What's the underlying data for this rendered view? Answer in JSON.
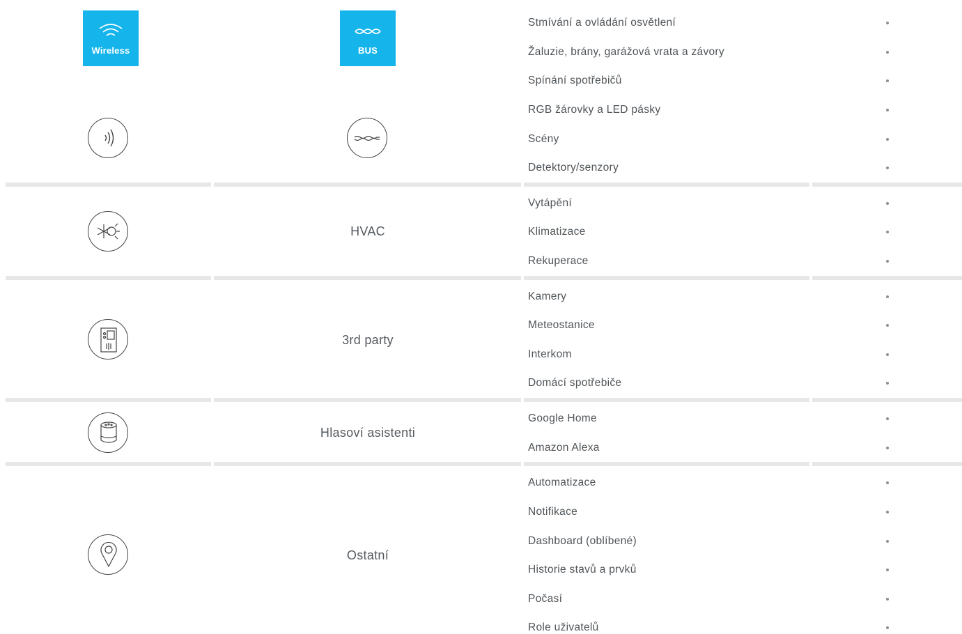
{
  "badges": {
    "wireless": "Wireless",
    "bus": "BUS",
    "color": "#15b5ec"
  },
  "sections": [
    {
      "icon": "signal-icon",
      "category": "",
      "features": [
        "Stmívání a ovládání osvětlení",
        "Žaluzie, brány, garážová vrata a závory",
        "Spínání spotřebičů",
        "RGB žárovky a LED pásky",
        "Scény",
        "Detektory/senzory"
      ]
    },
    {
      "icon": "hvac-icon",
      "category": "HVAC",
      "features": [
        "Vytápění",
        "Klimatizace",
        "Rekuperace"
      ]
    },
    {
      "icon": "intercom-icon",
      "category": "3rd party",
      "features": [
        "Kamery",
        "Meteostanice",
        "Interkom",
        "Domácí spotřebiče"
      ]
    },
    {
      "icon": "smart-speaker-icon",
      "category": "Hlasoví asistenti",
      "features": [
        "Google Home",
        "Amazon Alexa"
      ]
    },
    {
      "icon": "location-pin-icon",
      "category": "Ostatní",
      "features": [
        "Automatizace",
        "Notifikace",
        "Dashboard (oblíbené)",
        "Historie stavů a prvků",
        "Počasí",
        "Role uživatelů"
      ]
    }
  ],
  "bullet": "•"
}
